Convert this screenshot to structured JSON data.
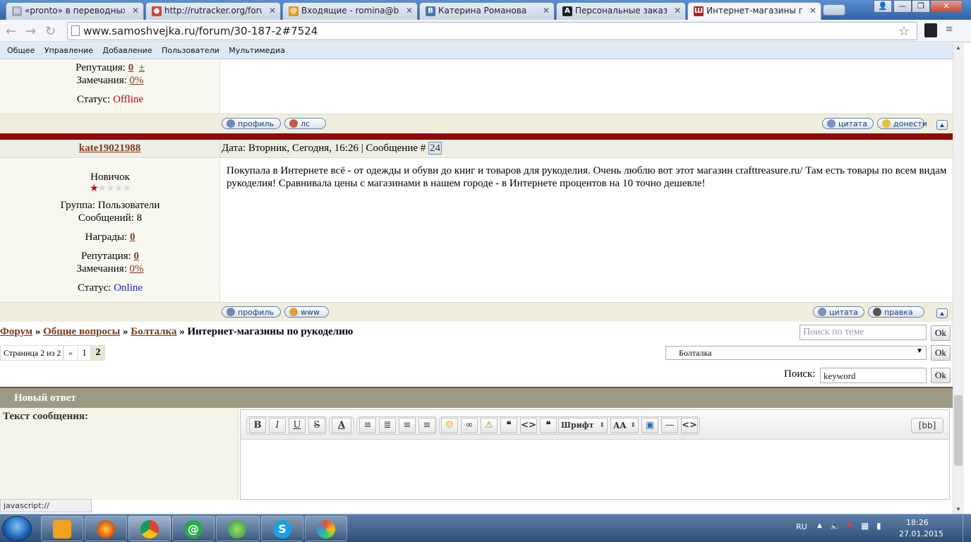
{
  "browser": {
    "tabs": [
      {
        "title": "«pronto» в переводных с",
        "icon": "document-icon",
        "active": false
      },
      {
        "title": "http://rutracker.org/forun",
        "icon": "rutracker-icon",
        "active": false
      },
      {
        "title": "Входящие - romina@bk.r",
        "icon": "mail-icon",
        "active": false
      },
      {
        "title": "Катерина Романова",
        "icon": "vk-icon",
        "active": false
      },
      {
        "title": "Персональные заказы / ",
        "icon": "letter-a-icon",
        "active": false
      },
      {
        "title": "Интернет-магазины по р",
        "icon": "samoshvejka-icon",
        "active": true
      }
    ],
    "url": "www.samoshvejka.ru/forum/30-187-2#7524",
    "bookmarks": [
      "Общее",
      "Управление",
      "Добавление",
      "Пользователи",
      "Мультимедиа"
    ]
  },
  "prev_post": {
    "reputation_label": "Репутация:",
    "reputation_value": "0",
    "reputation_toggle": "±",
    "warnings_label": "Замечания:",
    "warnings_value": "0%",
    "status_label": "Статус:",
    "status_value": "Offline",
    "buttons": {
      "profile": "профиль",
      "pm": "лс",
      "quote": "цитата",
      "report": "донести"
    }
  },
  "post": {
    "author": "kate19021988",
    "date_label": "Дата: Вторник, Сегодня, 16:26 | Сообщение #",
    "number": "24",
    "rank": "Новичок",
    "stars_filled": 1,
    "stars_total": 5,
    "group_label": "Группа:",
    "group_value": "Пользователи",
    "messages_label": "Сообщений:",
    "messages_value": "8",
    "awards_label": "Награды:",
    "awards_value": "0",
    "reputation_label": "Репутация:",
    "reputation_value": "0",
    "warnings_label": "Замечания:",
    "warnings_value": "0%",
    "status_label": "Статус:",
    "status_value": "Online",
    "body": "Покупала в Интернете всё - от одежды и обуви до книг и товаров для рукоделия. Очень люблю вот этот магазин crafttreasure.ru/ Там есть товары по всем видам рукоделия! Сравнивала цены с магазинами в нашем городе - в Интернете процентов на 10 точно дешевле!",
    "buttons": {
      "profile": "профиль",
      "www": "www",
      "quote": "цитата",
      "edit": "правка"
    }
  },
  "nav": {
    "breadcrumb": [
      {
        "label": "Форум",
        "link": true
      },
      {
        "label": "Общие вопросы",
        "link": true
      },
      {
        "label": "Болталка",
        "link": true
      },
      {
        "label": "Интернет-магазины по рукоделию",
        "link": false
      }
    ],
    "separator": "»",
    "topic_search_placeholder": "Поиск по теме",
    "ok": "Ok",
    "pages_label": "Страница 2 из 2",
    "prev": "«",
    "page1": "1",
    "page2": "2",
    "forum_select": "Болталка",
    "search_label": "Поиск:",
    "search_value": "keyword"
  },
  "reply": {
    "title": "Новый ответ",
    "text_label": "Текст сообщения:",
    "toolbar": {
      "bold": "B",
      "italic": "I",
      "underline": "U",
      "strike": "S",
      "color": "A",
      "font": "Шрифт",
      "size": "AA",
      "bb": "[bb]"
    }
  },
  "status_bar": "javascript://",
  "taskbar": {
    "lang": "RU",
    "time": "18:26",
    "date": "27.01.2015",
    "apps": [
      "media-player-icon",
      "firefox-icon",
      "chrome-icon",
      "mail-agent-icon",
      "messenger-icon",
      "skype-icon",
      "paint-icon"
    ]
  }
}
